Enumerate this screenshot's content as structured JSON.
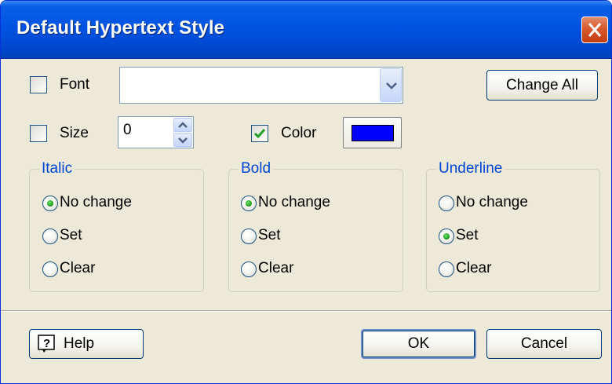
{
  "window": {
    "title": "Default Hypertext Style",
    "close_label": "Close"
  },
  "font": {
    "label": "Font",
    "checked": false,
    "value": ""
  },
  "change_all_label": "Change All",
  "size": {
    "label": "Size",
    "checked": false,
    "value": "0"
  },
  "color": {
    "label": "Color",
    "checked": true,
    "swatch": "#0000ff"
  },
  "groups": {
    "italic": {
      "title": "Italic",
      "options": [
        "No change",
        "Set",
        "Clear"
      ],
      "selected": "No change"
    },
    "bold": {
      "title": "Bold",
      "options": [
        "No change",
        "Set",
        "Clear"
      ],
      "selected": "No change"
    },
    "underline": {
      "title": "Underline",
      "options": [
        "No change",
        "Set",
        "Clear"
      ],
      "selected": "Set"
    }
  },
  "buttons": {
    "help": "Help",
    "ok": "OK",
    "cancel": "Cancel"
  },
  "icons": {
    "close": "close-icon",
    "combo": "chevron-down-icon",
    "help": "help-icon",
    "spin_up": "arrow-up-icon",
    "spin_down": "arrow-down-icon"
  },
  "colors": {
    "titlebar": "#0054e3",
    "dialog_bg": "#ece9d8",
    "group_title": "#0046d5",
    "close_button": "#d6592d"
  }
}
